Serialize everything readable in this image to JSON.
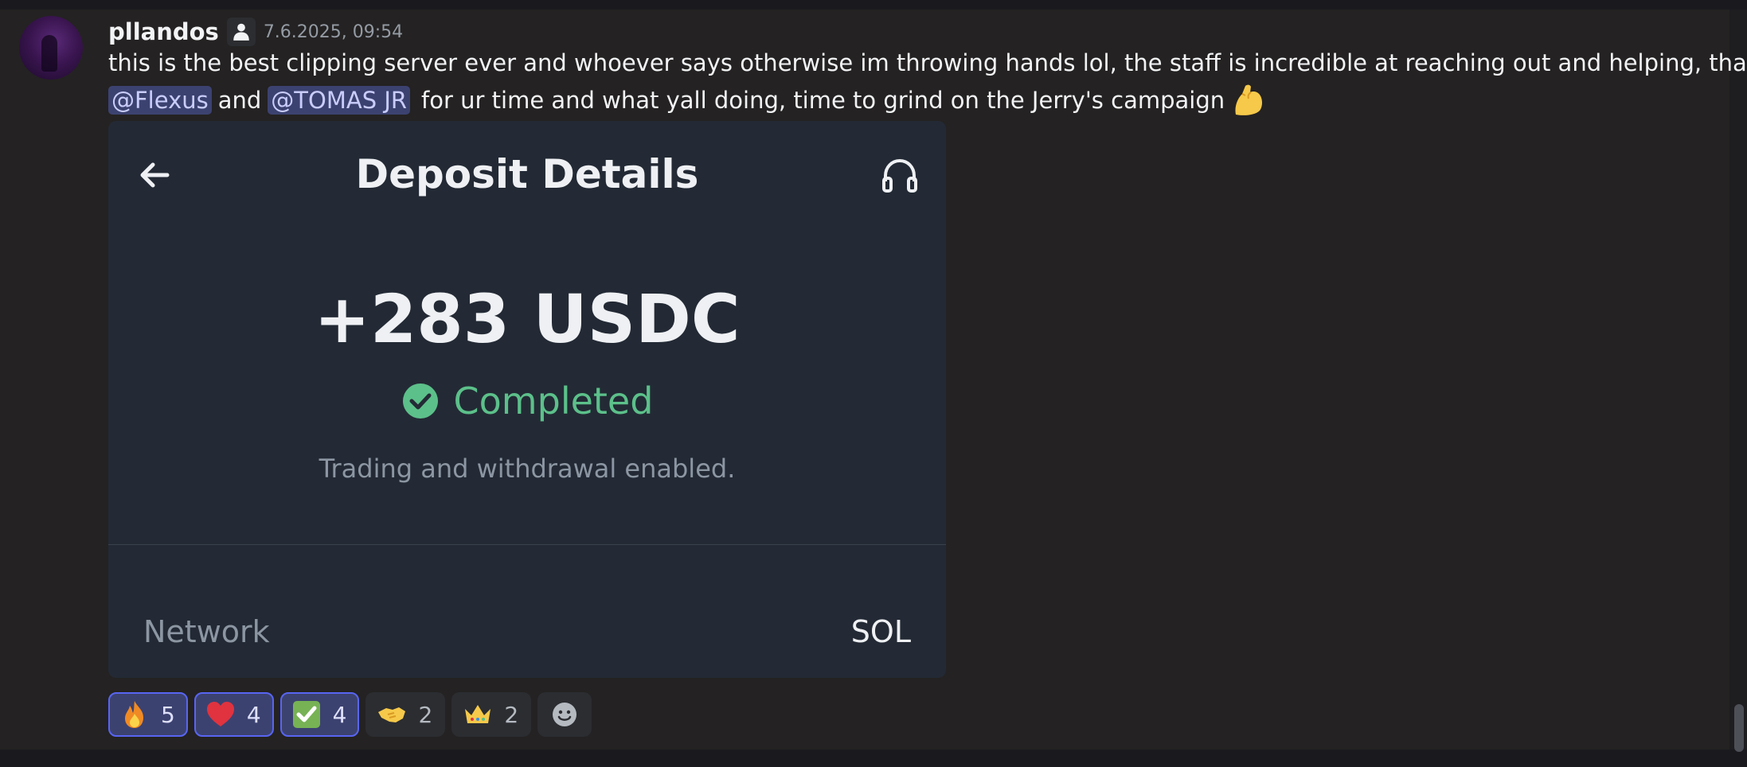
{
  "message": {
    "author": "pllandos",
    "author_icon": "person-icon",
    "timestamp": "7.6.2025, 09:54",
    "line1": "this is the best clipping server ever and whoever says otherwise im throwing hands lol, the staff is incredible at reaching out and helping, thank u",
    "mention1": "@Flexus",
    "and_text": "and",
    "mention2": "@TOMAS JR",
    "line2_rest": "for ur time and what yall doing, time to grind on the Jerry's campaign",
    "inline_emoji": "flexed-biceps-emoji"
  },
  "attachment": {
    "title": "Deposit Details",
    "back_icon": "arrow-left-icon",
    "support_icon": "headset-icon",
    "amount": "+283 USDC",
    "status": "Completed",
    "status_icon": "check-circle-icon",
    "status_color": "#5cc08a",
    "subtitle": "Trading and withdrawal enabled.",
    "network_label": "Network",
    "network_value": "SOL"
  },
  "reactions": [
    {
      "emoji": "fire",
      "count": "5",
      "active": true
    },
    {
      "emoji": "red-heart",
      "count": "4",
      "active": true
    },
    {
      "emoji": "check-mark-button",
      "count": "4",
      "active": true
    },
    {
      "emoji": "handshake",
      "count": "2",
      "active": false
    },
    {
      "emoji": "crown",
      "count": "2",
      "active": false
    }
  ],
  "add_reaction_icon": "smiley-add-icon",
  "colors": {
    "mention_bg": "#3c4270",
    "mention_text": "#c9cdfb",
    "active_reaction_border": "#5865f2"
  }
}
